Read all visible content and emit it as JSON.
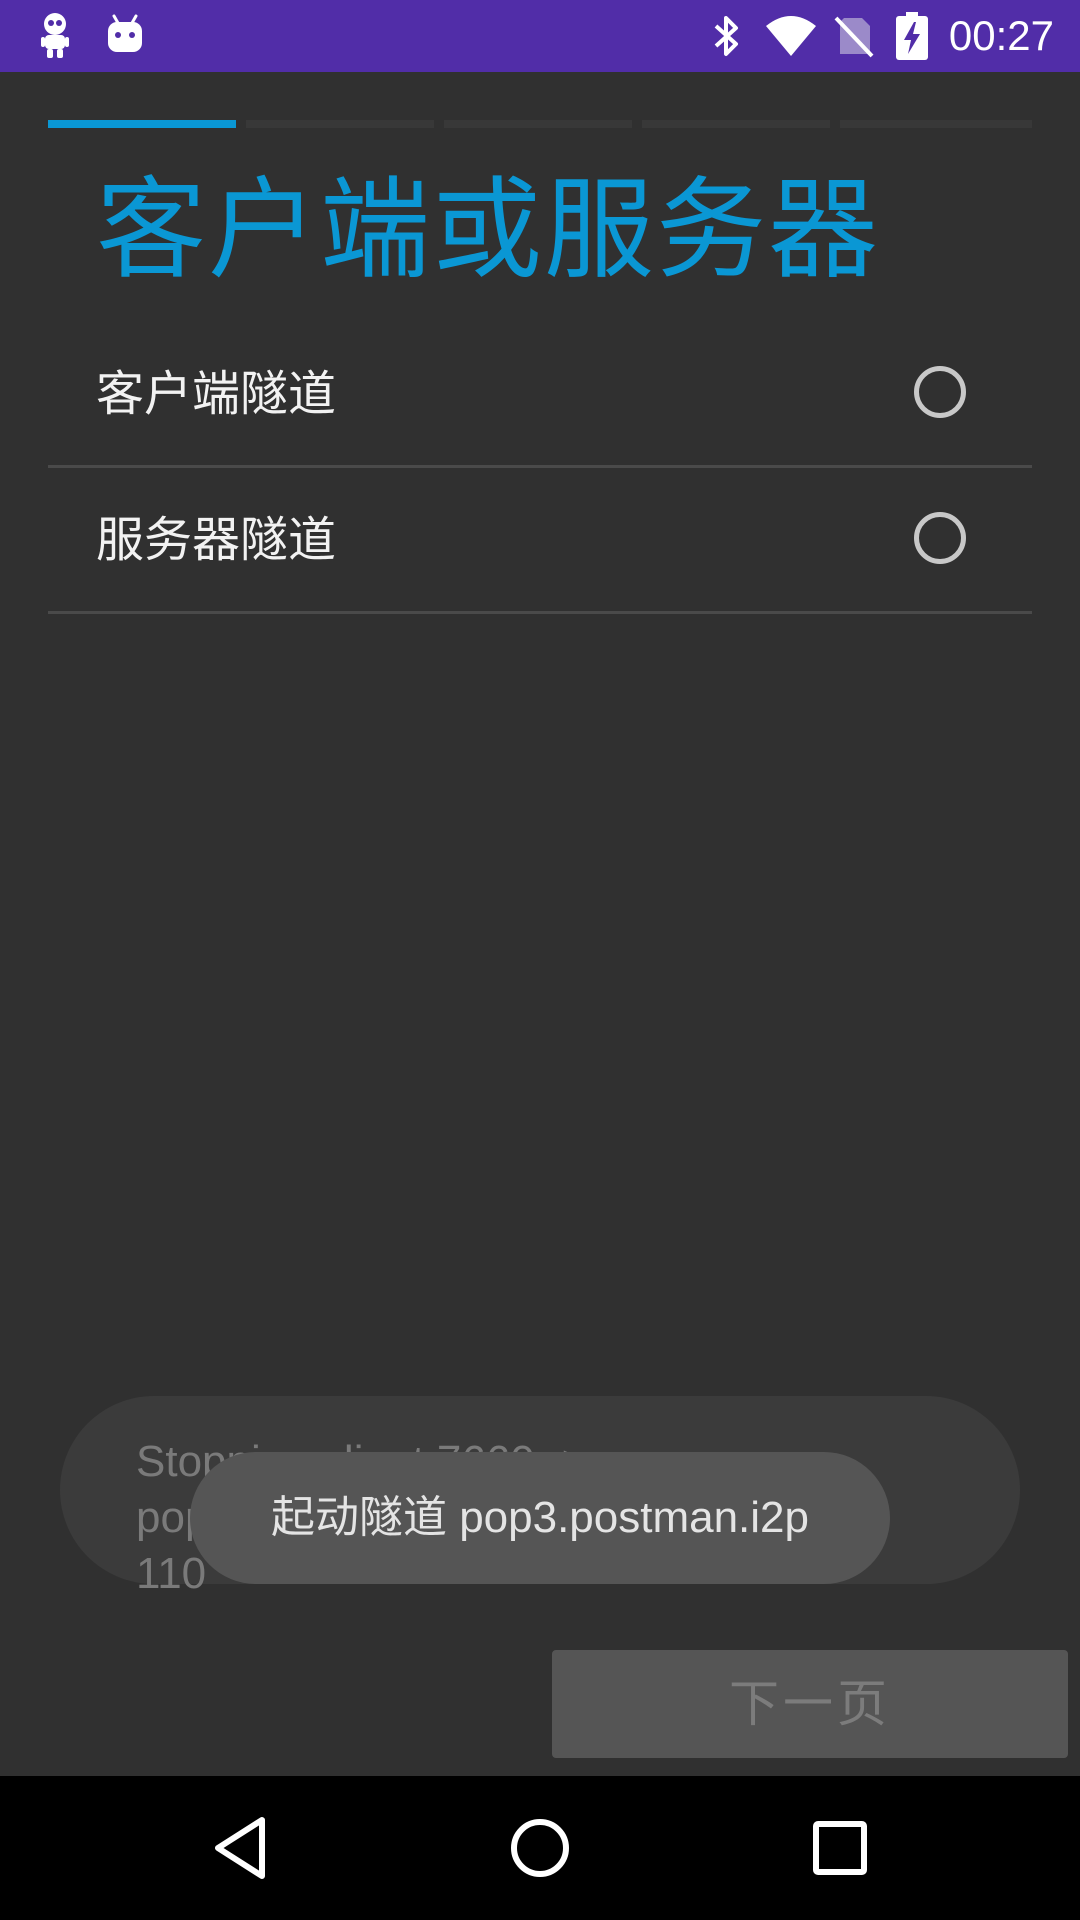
{
  "status_bar": {
    "left_icons": [
      "robot-icon",
      "android-icon"
    ],
    "right_icons": [
      "bluetooth-icon",
      "wifi-icon",
      "no-sim-icon",
      "battery-charging-icon"
    ],
    "time": "00:27",
    "background_color": "#512da8"
  },
  "wizard": {
    "steps_total": 5,
    "current_step": 1,
    "accent_color": "#0a97d4",
    "title": "客户端或服务器",
    "options": [
      {
        "label": "客户端隧道",
        "selected": false
      },
      {
        "label": "服务器隧道",
        "selected": false
      }
    ],
    "next_label": "下一页",
    "next_enabled": false
  },
  "toasts": {
    "background": "Stopping client 7660 -> pop.postman.i2p:\n110",
    "foreground": "起动隧道 pop3.postman.i2p"
  },
  "nav_bar": {
    "buttons": [
      "back-icon",
      "home-icon",
      "recents-icon"
    ]
  }
}
